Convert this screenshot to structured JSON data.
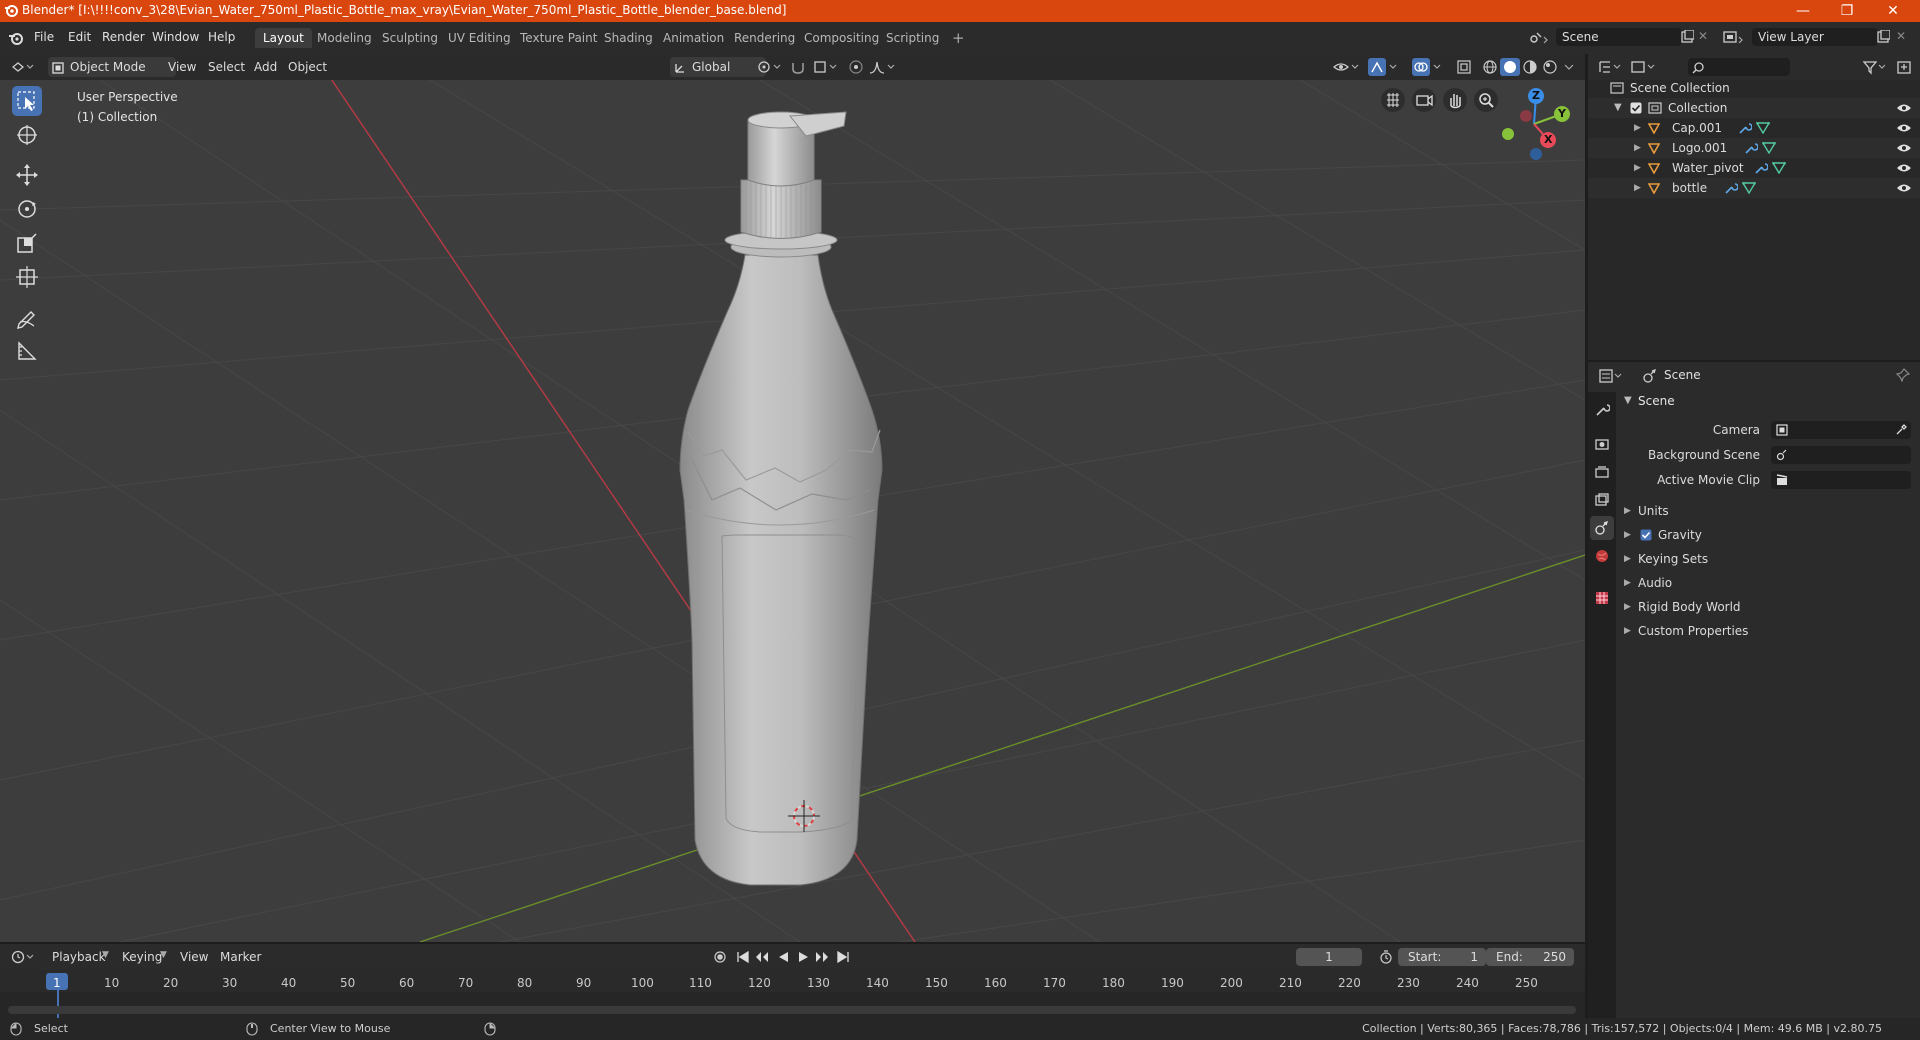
{
  "window": {
    "title": "Blender* [I:\\!!!!conv_3\\28\\Evian_Water_750ml_Plastic_Bottle_max_vray\\Evian_Water_750ml_Plastic_Bottle_blender_base.blend]",
    "minimize": "—",
    "restore": "❐",
    "close": "✕"
  },
  "menu": {
    "file": "File",
    "edit": "Edit",
    "render": "Render",
    "window": "Window",
    "help": "Help"
  },
  "workspaces": [
    "Layout",
    "Modeling",
    "Sculpting",
    "UV Editing",
    "Texture Paint",
    "Shading",
    "Animation",
    "Rendering",
    "Compositing",
    "Scripting"
  ],
  "add_workspace": "+",
  "scene_field": "Scene",
  "view_layer_field": "View Layer",
  "viewport_header": {
    "mode": "Object Mode",
    "view": "View",
    "select": "Select",
    "add": "Add",
    "object": "Object",
    "transform": "Global"
  },
  "viewport": {
    "perspective": "User Perspective",
    "collection": "(1) Collection",
    "gizmo": {
      "z": "Z",
      "y": "Y",
      "x": "X"
    }
  },
  "outliner": {
    "root": "Scene Collection",
    "collection": "Collection",
    "items": [
      "Cap.001",
      "Logo.001",
      "Water_pivot",
      "bottle"
    ]
  },
  "properties": {
    "context": "Scene",
    "panel": "Scene",
    "camera_label": "Camera",
    "bg_scene_label": "Background Scene",
    "movie_clip_label": "Active Movie Clip",
    "sections": [
      "Units",
      "Gravity",
      "Keying Sets",
      "Audio",
      "Rigid Body World",
      "Custom Properties"
    ],
    "gravity_checked": true
  },
  "timeline": {
    "playback": "Playback",
    "keying": "Keying",
    "view": "View",
    "marker": "Marker",
    "current_frame": "1",
    "start_label": "Start:",
    "start": "1",
    "end_label": "End:",
    "end": "250",
    "ticks": [
      "1",
      "10",
      "20",
      "30",
      "40",
      "50",
      "60",
      "70",
      "80",
      "90",
      "100",
      "110",
      "120",
      "130",
      "140",
      "150",
      "160",
      "170",
      "180",
      "190",
      "200",
      "210",
      "220",
      "230",
      "240",
      "250"
    ]
  },
  "status": {
    "select": "Select",
    "center_view": "Center View to Mouse",
    "stats": "Collection | Verts:80,365 | Faces:78,786 | Tris:157,572 | Objects:0/4 | Mem: 49.6 MB | v2.80.75"
  },
  "colors": {
    "titlebar": "#d9470f",
    "accent": "#4772b3",
    "object_orange": "#e89a3c",
    "modifier_blue": "#5fa8e8",
    "mesh_green": "#52c9a0",
    "axis_x": "#e84a5a",
    "axis_y": "#88c23a",
    "axis_z": "#3a8ee8"
  }
}
